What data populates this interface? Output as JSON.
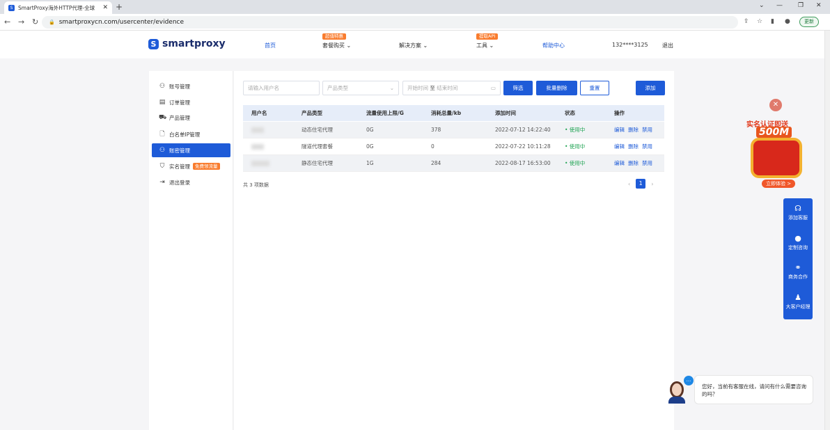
{
  "browser": {
    "tab_title": "SmartProxy海外HTTP代理-全球",
    "url": "smartproxycn.com/usercenter/evidence",
    "update_label": "更新"
  },
  "header": {
    "logo": "smartproxy",
    "nav": {
      "home": "首页",
      "packages": "套餐购买",
      "packages_badge": "超值特惠",
      "solutions": "解决方案",
      "tools": "工具",
      "tools_badge": "提取API",
      "help": "帮助中心",
      "phone": "132****3125",
      "logout": "退出"
    }
  },
  "sidebar": {
    "items": [
      {
        "label": "账号管理",
        "icon": "user-icon"
      },
      {
        "label": "订单管理",
        "icon": "order-icon"
      },
      {
        "label": "产品管理",
        "icon": "cart-icon"
      },
      {
        "label": "白名单IP管理",
        "icon": "file-icon"
      },
      {
        "label": "账密管理",
        "icon": "users-icon"
      },
      {
        "label": "实名管理",
        "icon": "shield-icon",
        "badge": "免费领流量"
      },
      {
        "label": "退出登录",
        "icon": "logout-icon"
      }
    ]
  },
  "filters": {
    "username_placeholder": "请输入用户名",
    "product_placeholder": "产品类型",
    "start_placeholder": "开始时间",
    "range_sep": "至",
    "end_placeholder": "结束时间",
    "filter_btn": "筛选",
    "batch_delete_btn": "批量删除",
    "reset_btn": "重置",
    "add_btn": "添加"
  },
  "table": {
    "headers": [
      "用户名",
      "产品类型",
      "流量使用上限/G",
      "消耗总量/kb",
      "添加时间",
      "状态",
      "操作"
    ],
    "rows": [
      {
        "product": "动态住宅代理",
        "limit": "0G",
        "used": "378",
        "time": "2022-07-12 14:22:40",
        "status": "• 使用中"
      },
      {
        "product": "隧道代理套餐",
        "limit": "0G",
        "used": "0",
        "time": "2022-07-22 10:11:28",
        "status": "• 使用中"
      },
      {
        "product": "静态住宅代理",
        "limit": "1G",
        "used": "284",
        "time": "2022-08-17 16:53:00",
        "status": "• 使用中"
      }
    ],
    "actions": [
      "编辑",
      "删除",
      "禁用"
    ],
    "total": "共 3 项数据",
    "page": "1"
  },
  "promo": {
    "line1": "实名认证即送",
    "line2": "500M",
    "cta": "立即体验 >"
  },
  "service": {
    "items": [
      "添加客服",
      "定制咨询",
      "商务合作",
      "大客户经理"
    ]
  },
  "chat": {
    "message": "您好，当前有客服在线，请问有什么需要咨询的吗？"
  }
}
